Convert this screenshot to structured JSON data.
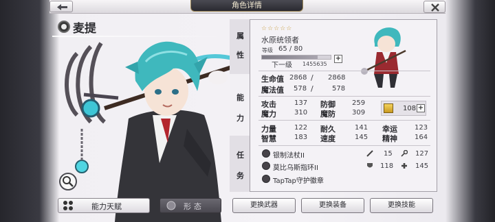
{
  "header": {
    "title": "角色详情"
  },
  "character": {
    "name": "麦提",
    "stars": "☆☆☆☆☆",
    "job": "水原统领者"
  },
  "level": {
    "label": "等级",
    "value": "65 / 80",
    "next_label": "下一级",
    "next_exp": "1455635",
    "progress": 0.8125
  },
  "tabs": {
    "attributes": [
      "属",
      "性"
    ],
    "abilities": [
      "能",
      "力"
    ],
    "tasks": [
      "任",
      "务"
    ]
  },
  "vitals": {
    "hp_label": "生命值",
    "hp_current": "2868",
    "hp_max": "2868",
    "mp_label": "魔法值",
    "mp_current": "578",
    "mp_max": "578",
    "slash": "/"
  },
  "stats": {
    "atk_label": "攻击",
    "atk": "137",
    "def_label": "防御",
    "def": "259",
    "matk_label": "魔力",
    "matk": "310",
    "mdef_label": "魔防",
    "mdef": "309",
    "str_label": "力量",
    "str": "122",
    "end_label": "耐久",
    "end": "141",
    "luck_label": "幸运",
    "luck": "123",
    "int_label": "智慧",
    "int": "183",
    "spd_label": "速度",
    "spd": "145",
    "spi_label": "精神",
    "spi": "164",
    "points": "108"
  },
  "equipment": [
    {
      "name": "银制法杖II",
      "stat1": "15",
      "stat2": "127"
    },
    {
      "name": "莫比乌斯指环II",
      "stat1": "118",
      "stat2": "145"
    },
    {
      "name": "TapTap守护徽章"
    }
  ],
  "buttons": {
    "talent": "能力天赋",
    "form": "形态",
    "change_weapon": "更换武器",
    "change_gear": "更换装备",
    "change_skill": "更换技能"
  },
  "colors": {
    "accent_gold": "#c79b3a",
    "panel_bg": "#f4f2f6",
    "hair_teal": "#3fb8bd"
  }
}
